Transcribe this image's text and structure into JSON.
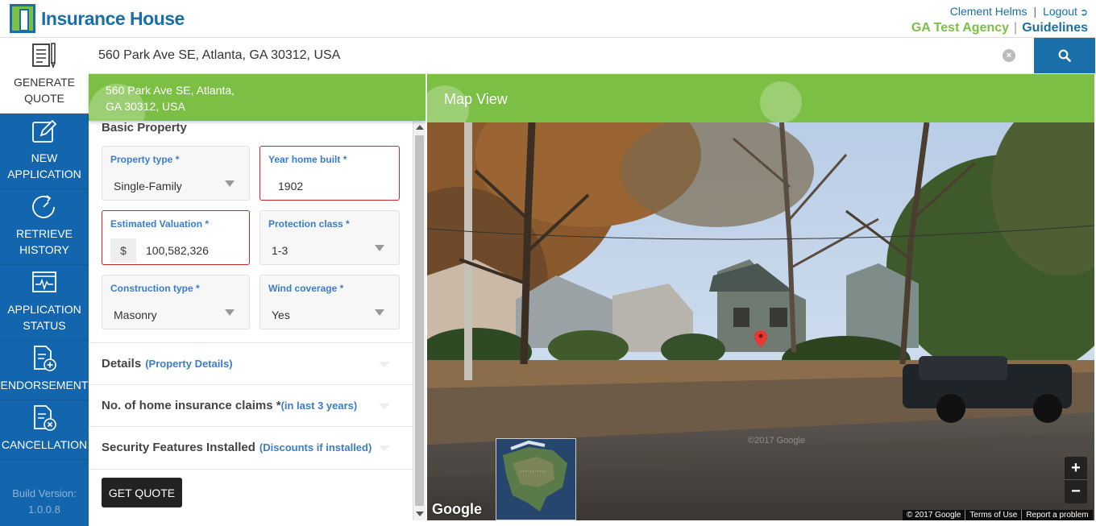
{
  "app": {
    "brand": "Insurance House"
  },
  "header": {
    "user_name": "Clement Helms",
    "logout_label": "Logout",
    "agency": "GA Test Agency",
    "guidelines": "Guidelines"
  },
  "sidebar": {
    "items": [
      {
        "label_line1": "GENERATE",
        "label_line2": "QUOTE",
        "icon": "document-pencil-icon"
      },
      {
        "label_line1": "NEW",
        "label_line2": "APPLICATION",
        "icon": "edit-icon"
      },
      {
        "label_line1": "RETRIEVE",
        "label_line2": "HISTORY",
        "icon": "history-icon"
      },
      {
        "label_line1": "APPLICATION",
        "label_line2": "STATUS",
        "icon": "pulse-icon"
      },
      {
        "label_line1": "ENDORSEMENT",
        "icon": "document-add-icon"
      },
      {
        "label_line1": "CANCELLATION",
        "icon": "document-cancel-icon"
      }
    ],
    "build_label": "Build Version:",
    "build_version": "1.0.0.8"
  },
  "search": {
    "value": "560 Park Ave SE, Atlanta, GA 30312, USA"
  },
  "address_banner": {
    "line1": "560 Park Ave SE, Atlanta,",
    "line2": "GA 30312, USA"
  },
  "form": {
    "section_title": "Basic Property",
    "fields": {
      "property_type": {
        "label": "Property type *",
        "value": "Single-Family"
      },
      "year_built": {
        "label": "Year home built *",
        "value": "1902"
      },
      "valuation": {
        "label": "Estimated Valuation *",
        "prefix": "$",
        "value": "100,582,326"
      },
      "protection_class": {
        "label": "Protection class *",
        "value": "1-3"
      },
      "construction_type": {
        "label": "Construction type *",
        "value": "Masonry"
      },
      "wind_coverage": {
        "label": "Wind coverage *",
        "value": "Yes"
      }
    },
    "sections": [
      {
        "title": "Details",
        "sub": "(Property Details)"
      },
      {
        "title": "No. of home insurance claims *",
        "sub": "(in last 3 years)"
      },
      {
        "title": "Security Features Installed",
        "sub": "(Discounts if installed)"
      }
    ],
    "get_quote_label": "GET QUOTE"
  },
  "map": {
    "title": "Map View",
    "google_label": "Google",
    "watermark": "©2017 Google",
    "zoom_in": "+",
    "zoom_out": "−",
    "attribution": [
      "© 2017 Google",
      "Terms of Use",
      "Report a problem"
    ]
  },
  "colors": {
    "brand_blue": "#1366ae",
    "brand_green": "#7bbf44",
    "error_red": "#c62828",
    "label_blue": "#3b7dc8"
  }
}
